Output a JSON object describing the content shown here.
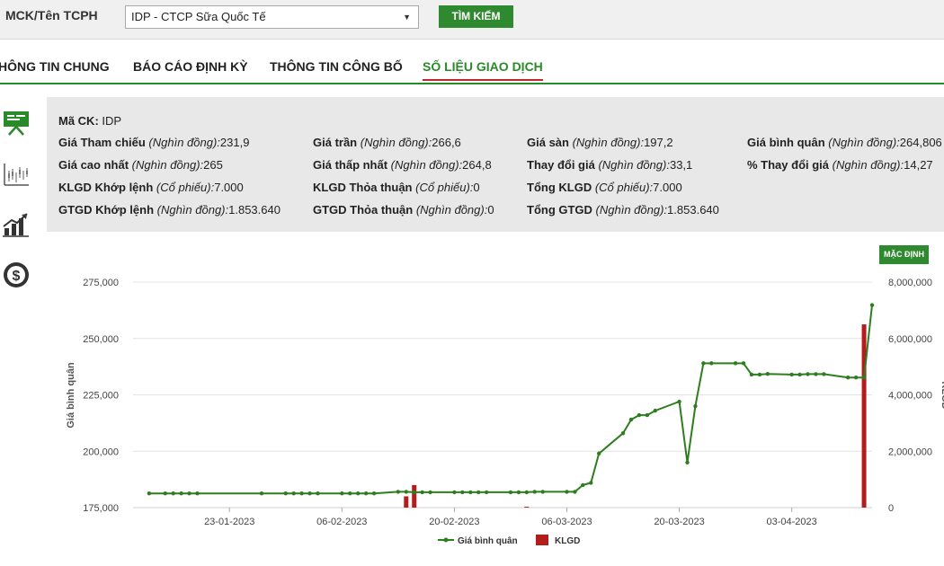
{
  "search": {
    "label": "MCK/Tên TCPH",
    "selected": "IDP - CTCP Sữa Quốc Tế",
    "button": "TÌM KIẾM"
  },
  "tabs": [
    {
      "label": "HÔNG TIN CHUNG"
    },
    {
      "label": "BÁO CÁO ĐỊNH KỲ"
    },
    {
      "label": "THÔNG TIN CÔNG BỐ"
    },
    {
      "label": "SỐ LIỆU GIAO DỊCH",
      "active": true
    }
  ],
  "rail_icons": [
    "presentation-icon",
    "candlestick-icon",
    "bar-growth-icon",
    "dollar-coin-icon"
  ],
  "info": {
    "code_label": "Mã CK:",
    "code_value": "IDP",
    "rows": [
      [
        {
          "label": "Giá Tham chiếu",
          "unit": "(Nghìn đồng):",
          "value": "231,9"
        },
        {
          "label": "Giá trần",
          "unit": "(Nghìn đồng):",
          "value": "266,6"
        },
        {
          "label": "Giá sàn",
          "unit": "(Nghìn đồng):",
          "value": "197,2"
        },
        {
          "label": "Giá bình quân",
          "unit": "(Nghìn đồng):",
          "value": "264,806"
        }
      ],
      [
        {
          "label": "Giá cao nhất",
          "unit": "(Nghìn đồng):",
          "value": "265"
        },
        {
          "label": "Giá thấp nhất",
          "unit": "(Nghìn đồng):",
          "value": "264,8"
        },
        {
          "label": "Thay đổi giá",
          "unit": "(Nghìn đồng):",
          "value": "33,1"
        },
        {
          "label": "% Thay đổi giá",
          "unit": "(Nghìn đồng):",
          "value": "14,27"
        }
      ],
      [
        {
          "label": "KLGD Khớp lệnh",
          "unit": "(Cổ phiếu):",
          "value": "7.000"
        },
        {
          "label": "KLGD Thỏa thuận",
          "unit": "(Cổ phiếu):",
          "value": "0"
        },
        {
          "label": "Tổng KLGD",
          "unit": "(Cổ phiếu):",
          "value": "7.000"
        }
      ],
      [
        {
          "label": "GTGD Khớp lệnh",
          "unit": "(Nghìn đồng):",
          "value": "1.853.640"
        },
        {
          "label": "GTGD Thỏa thuận",
          "unit": "(Nghìn đồng):",
          "value": "0"
        },
        {
          "label": "Tổng GTGD",
          "unit": "(Nghìn đồng):",
          "value": "1.853.640"
        }
      ]
    ]
  },
  "chart_button": "MẶC ĐỊNH",
  "colors": {
    "accent": "#2a8a2a",
    "price_line": "#2e7d1f",
    "volume_bar": "#b51c1c"
  },
  "chart_data": {
    "type": "line",
    "ylabel": "Giá bình quân",
    "y2label": "KLGD",
    "ylim": [
      175000,
      275000
    ],
    "y2lim": [
      0,
      8000000
    ],
    "y_ticks": [
      "275,000",
      "250,000",
      "225,000",
      "200,000",
      "175,000"
    ],
    "y2_ticks": [
      "8,000,000",
      "6,000,000",
      "4,000,000",
      "2,000,000",
      "0"
    ],
    "x_range": [
      "2023-01-11",
      "2023-04-13"
    ],
    "x_ticks": [
      {
        "date": "2023-01-23",
        "label": "23-01-2023"
      },
      {
        "date": "2023-02-06",
        "label": "06-02-2023"
      },
      {
        "date": "2023-02-20",
        "label": "20-02-2023"
      },
      {
        "date": "2023-03-06",
        "label": "06-03-2023"
      },
      {
        "date": "2023-03-20",
        "label": "20-03-2023"
      },
      {
        "date": "2023-04-03",
        "label": "03-04-2023"
      }
    ],
    "legend": {
      "position": "bottom",
      "items": [
        "Giá bình quân",
        "KLGD"
      ]
    },
    "series": [
      {
        "name": "Giá bình quân",
        "kind": "line",
        "points": [
          [
            "2023-01-13",
            181300
          ],
          [
            "2023-01-15",
            181300
          ],
          [
            "2023-01-16",
            181300
          ],
          [
            "2023-01-17",
            181300
          ],
          [
            "2023-01-18",
            181300
          ],
          [
            "2023-01-19",
            181300
          ],
          [
            "2023-01-27",
            181300
          ],
          [
            "2023-01-30",
            181300
          ],
          [
            "2023-01-31",
            181300
          ],
          [
            "2023-02-01",
            181300
          ],
          [
            "2023-02-02",
            181300
          ],
          [
            "2023-02-03",
            181300
          ],
          [
            "2023-02-06",
            181300
          ],
          [
            "2023-02-07",
            181300
          ],
          [
            "2023-02-08",
            181300
          ],
          [
            "2023-02-09",
            181300
          ],
          [
            "2023-02-10",
            181300
          ],
          [
            "2023-02-13",
            182000
          ],
          [
            "2023-02-14",
            182000
          ],
          [
            "2023-02-15",
            181800
          ],
          [
            "2023-02-16",
            181800
          ],
          [
            "2023-02-17",
            181800
          ],
          [
            "2023-02-20",
            181800
          ],
          [
            "2023-02-21",
            181800
          ],
          [
            "2023-02-22",
            181800
          ],
          [
            "2023-02-23",
            181800
          ],
          [
            "2023-02-24",
            181800
          ],
          [
            "2023-02-27",
            181800
          ],
          [
            "2023-02-28",
            181800
          ],
          [
            "2023-03-01",
            181800
          ],
          [
            "2023-03-02",
            182000
          ],
          [
            "2023-03-03",
            182000
          ],
          [
            "2023-03-06",
            182000
          ],
          [
            "2023-03-07",
            182000
          ],
          [
            "2023-03-08",
            185000
          ],
          [
            "2023-03-09",
            186000
          ],
          [
            "2023-03-10",
            199000
          ],
          [
            "2023-03-13",
            208000
          ],
          [
            "2023-03-14",
            214000
          ],
          [
            "2023-03-15",
            216000
          ],
          [
            "2023-03-16",
            216000
          ],
          [
            "2023-03-17",
            218000
          ],
          [
            "2023-03-20",
            222000
          ],
          [
            "2023-03-21",
            195000
          ],
          [
            "2023-03-22",
            220000
          ],
          [
            "2023-03-23",
            239000
          ],
          [
            "2023-03-24",
            239000
          ],
          [
            "2023-03-27",
            239000
          ],
          [
            "2023-03-28",
            239000
          ],
          [
            "2023-03-29",
            234000
          ],
          [
            "2023-03-30",
            234000
          ],
          [
            "2023-03-31",
            234300
          ],
          [
            "2023-04-03",
            234000
          ],
          [
            "2023-04-04",
            234000
          ],
          [
            "2023-04-05",
            234200
          ],
          [
            "2023-04-06",
            234200
          ],
          [
            "2023-04-07",
            234200
          ],
          [
            "2023-04-10",
            232700
          ],
          [
            "2023-04-11",
            232700
          ],
          [
            "2023-04-12",
            232700
          ],
          [
            "2023-04-13",
            264806
          ]
        ]
      },
      {
        "name": "KLGD",
        "kind": "bar",
        "points": [
          [
            "2023-02-14",
            400000
          ],
          [
            "2023-02-15",
            800000
          ],
          [
            "2023-03-01",
            30000
          ],
          [
            "2023-04-12",
            6500000
          ]
        ]
      }
    ]
  }
}
